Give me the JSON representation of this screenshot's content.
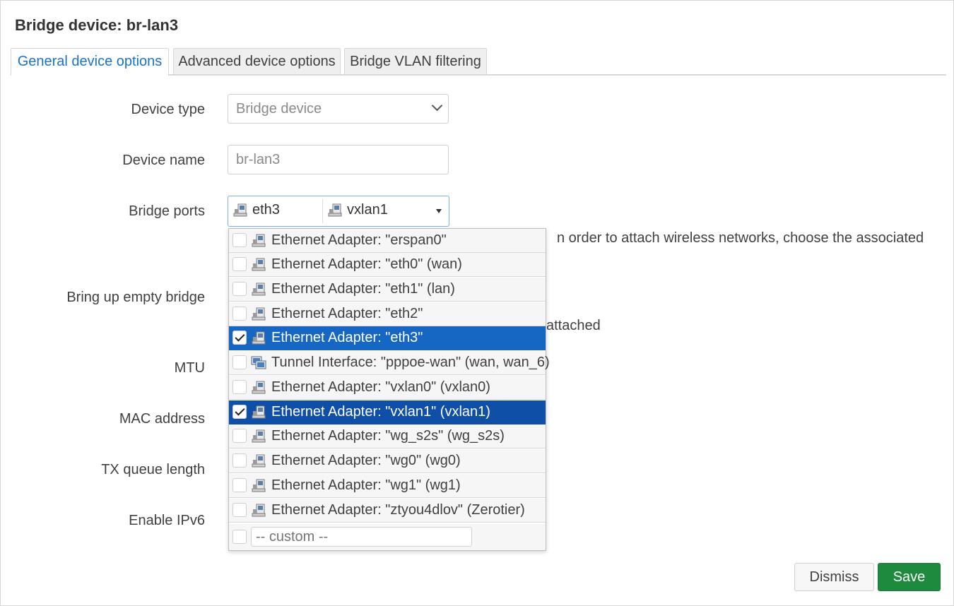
{
  "modal": {
    "title": "Bridge device: br-lan3",
    "tabs": [
      "General device options",
      "Advanced device options",
      "Bridge VLAN filtering"
    ]
  },
  "form": {
    "device_type": {
      "label": "Device type",
      "value": "Bridge device"
    },
    "device_name": {
      "label": "Device name",
      "value": "br-lan3"
    },
    "bridge_ports": {
      "label": "Bridge ports",
      "selected": [
        "eth3",
        "vxlan1"
      ],
      "desc_visible": "n order to attach wireless networks, choose the associated"
    },
    "bring_up_empty_bridge": {
      "label": "Bring up empty bridge",
      "desc_visible": "attached"
    },
    "mtu": {
      "label": "MTU"
    },
    "mac_address": {
      "label": "MAC address"
    },
    "tx_queue_length": {
      "label": "TX queue length"
    },
    "enable_ipv6": {
      "label": "Enable IPv6"
    }
  },
  "dropdown": {
    "options": [
      {
        "text": "Ethernet Adapter: \"erspan0\"",
        "checked": false,
        "icon": "ethernet-icon"
      },
      {
        "text": "Ethernet Adapter: \"eth0\" (wan)",
        "checked": false,
        "icon": "ethernet-icon"
      },
      {
        "text": "Ethernet Adapter: \"eth1\" (lan)",
        "checked": false,
        "icon": "ethernet-icon"
      },
      {
        "text": "Ethernet Adapter: \"eth2\"",
        "checked": false,
        "icon": "ethernet-icon"
      },
      {
        "text": "Ethernet Adapter: \"eth3\"",
        "checked": true,
        "icon": "ethernet-icon"
      },
      {
        "text": "Tunnel Interface: \"pppoe-wan\" (wan, wan_6)",
        "checked": false,
        "icon": "tunnel-icon"
      },
      {
        "text": "Ethernet Adapter: \"vxlan0\" (vxlan0)",
        "checked": false,
        "icon": "ethernet-icon"
      },
      {
        "text": "Ethernet Adapter: \"vxlan1\" (vxlan1)",
        "checked": true,
        "icon": "ethernet-icon"
      },
      {
        "text": "Ethernet Adapter: \"wg_s2s\" (wg_s2s)",
        "checked": false,
        "icon": "ethernet-icon"
      },
      {
        "text": "Ethernet Adapter: \"wg0\" (wg0)",
        "checked": false,
        "icon": "ethernet-icon"
      },
      {
        "text": "Ethernet Adapter: \"wg1\" (wg1)",
        "checked": false,
        "icon": "ethernet-icon"
      },
      {
        "text": "Ethernet Adapter: \"ztyou4dlov\" (Zerotier)",
        "checked": false,
        "icon": "ethernet-icon"
      }
    ],
    "custom_placeholder": "-- custom --"
  },
  "buttons": {
    "dismiss": "Dismiss",
    "save": "Save"
  },
  "colors": {
    "accent": "#1a73c8",
    "selected_row": "#1567c3",
    "save_button": "#1e8a3e"
  }
}
